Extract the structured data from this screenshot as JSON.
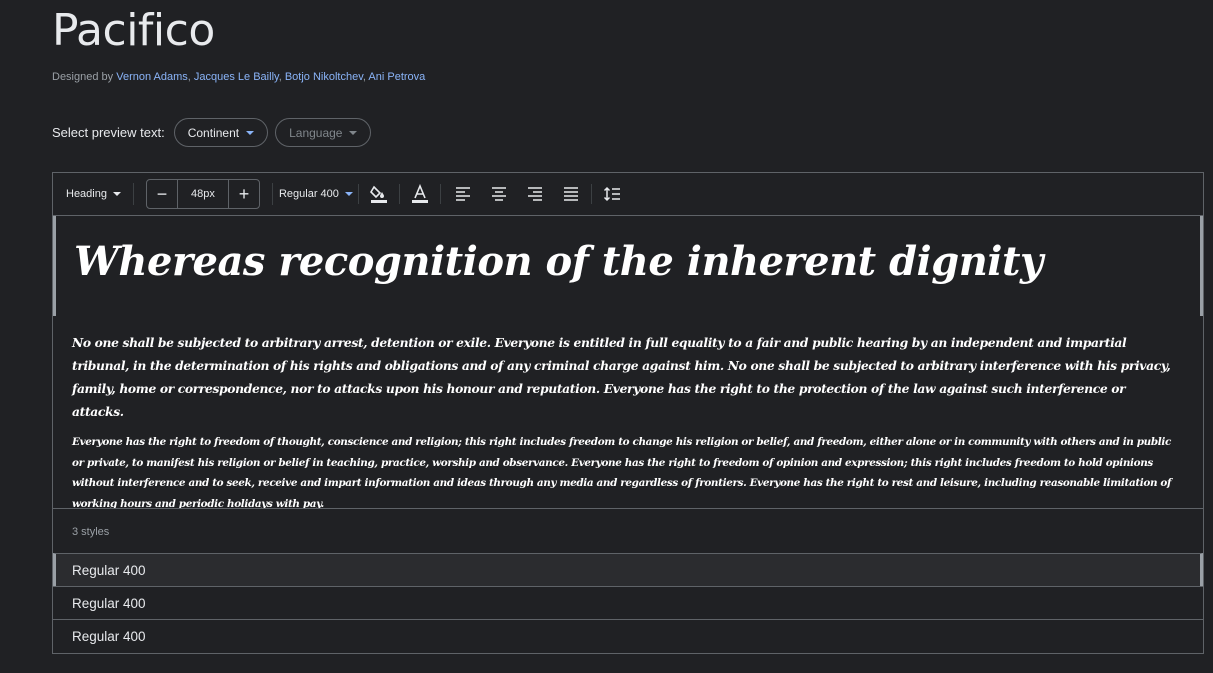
{
  "font": {
    "name": "Pacifico",
    "designed_by_label": "Designed by",
    "designers": [
      "Vernon Adams",
      "Jacques Le Bailly",
      "Botjo Nikoltchev",
      "Ani Petrova"
    ]
  },
  "preview": {
    "label": "Select preview text:",
    "continent_chip": "Continent",
    "language_chip": "Language"
  },
  "toolbar": {
    "text_type": "Heading",
    "font_size": "48px",
    "decrement": "−",
    "increment": "+",
    "weight": "Regular 400",
    "icons": [
      "fill-color-icon",
      "text-color-icon",
      "align-left-icon",
      "align-center-icon",
      "align-right-icon",
      "align-justify-icon",
      "line-height-icon"
    ]
  },
  "sample": {
    "heading": "Whereas recognition of the inherent dignity",
    "paragraph1": "No one shall be subjected to arbitrary arrest, detention or exile. Everyone is entitled in full equality to a fair and public hearing by an independent and impartial tribunal, in the determination of his rights and obligations and of any criminal charge against him. No one shall be subjected to arbitrary interference with his privacy, family, home or correspondence, nor to attacks upon his honour and reputation. Everyone has the right to the protection of the law against such interference or attacks.",
    "paragraph2": "Everyone has the right to freedom of thought, conscience and religion; this right includes freedom to change his religion or belief, and freedom, either alone or in community with others and in public or private, to manifest his religion or belief in teaching, practice, worship and observance. Everyone has the right to freedom of opinion and expression; this right includes freedom to hold opinions without interference and to seek, receive and impart information and ideas through any media and regardless of frontiers. Everyone has the right to rest and leisure, including reasonable limitation of working hours and periodic holidays with pay."
  },
  "styles": {
    "count_label": "3 styles",
    "items": [
      "Regular 400",
      "Regular 400",
      "Regular 400"
    ]
  },
  "colors": {
    "background": "#202124",
    "link": "#8ab4f8",
    "border": "#5f6368"
  }
}
